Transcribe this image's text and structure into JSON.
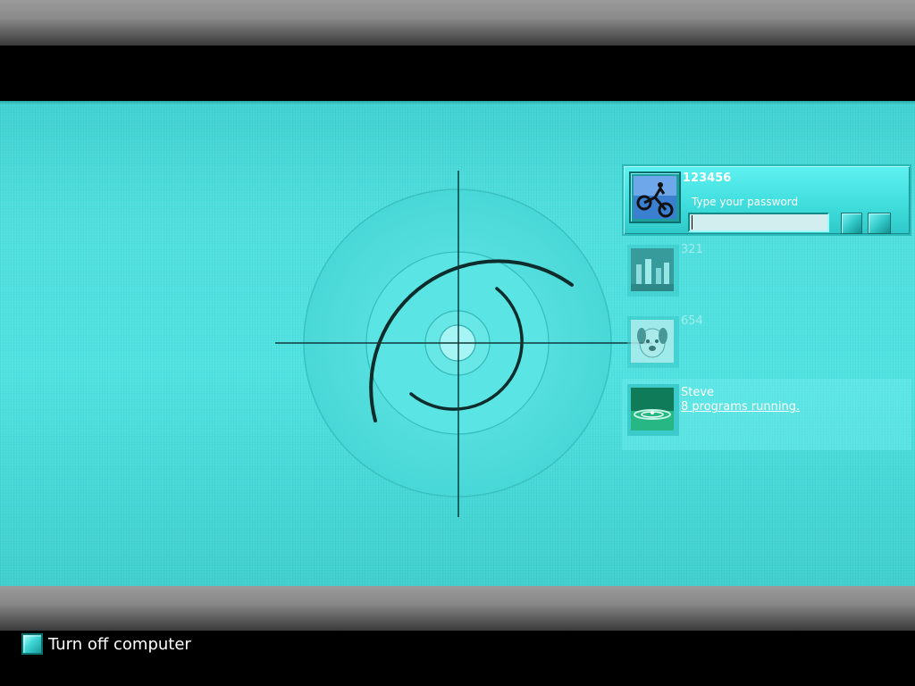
{
  "users": [
    {
      "name": "123456",
      "password_hint": "Type your password",
      "password_value": "",
      "selected": true,
      "avatar_icon": "motocross-bike-icon"
    },
    {
      "name": "321",
      "avatar_icon": "chess-pieces-icon"
    },
    {
      "name": "654",
      "avatar_icon": "dog-icon"
    },
    {
      "name": "Steve",
      "status": "8 programs running.",
      "avatar_icon": "water-drop-icon"
    }
  ],
  "footer": {
    "turn_off_label": "Turn off computer",
    "turn_off_icon": "power-icon"
  },
  "colors": {
    "accent": "#50e3e2",
    "panel_selected": "#3fdcdc",
    "bevel": "#8a8a8a"
  }
}
